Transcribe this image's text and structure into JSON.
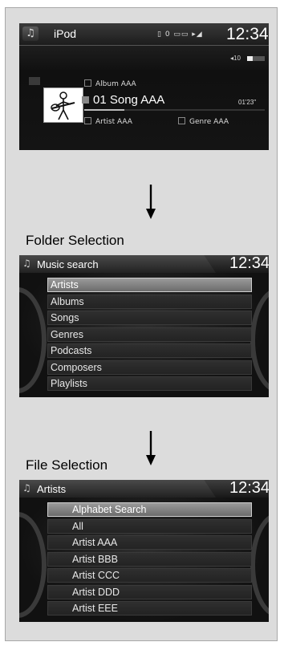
{
  "now_playing": {
    "source": "iPod",
    "clock": "12:34",
    "status_icons": "▯ 0 ▭▭ ▸◢",
    "volume": "◂10",
    "volume_level": 0.3,
    "album": "Album AAA",
    "song": "01 Song AAA",
    "elapsed": "01'23\"",
    "progress": 0.22,
    "artist": "Artist AAA",
    "genre": "Genre AAA"
  },
  "folder_selection": {
    "caption": "Folder Selection",
    "title": "Music search",
    "clock": "12:34",
    "items": [
      "Artists",
      "Albums",
      "Songs",
      "Genres",
      "Podcasts",
      "Composers",
      "Playlists"
    ],
    "selected_index": 0
  },
  "file_selection": {
    "caption": "File Selection",
    "title": "Artists",
    "clock": "12:34",
    "items": [
      "Alphabet Search",
      "All",
      "Artist AAA",
      "Artist BBB",
      "Artist CCC",
      "Artist DDD",
      "Artist EEE"
    ],
    "selected_index": 0
  },
  "icons": [
    "music-note-icon",
    "down-arrow-icon"
  ]
}
